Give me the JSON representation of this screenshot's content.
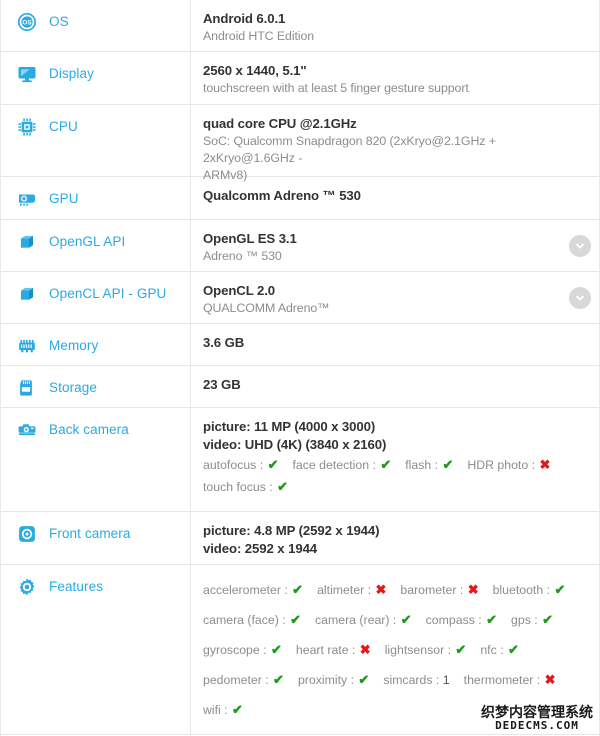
{
  "rows": [
    {
      "id": "os",
      "label": "OS",
      "icon": "os-icon",
      "primary": "Android 6.0.1",
      "secondary": [
        "Android HTC Edition"
      ],
      "expandable": false
    },
    {
      "id": "display",
      "label": "Display",
      "icon": "monitor-icon",
      "primary": "2560 x 1440, 5.1\"",
      "secondary": [
        "touchscreen with at least 5 finger gesture support"
      ],
      "expandable": false
    },
    {
      "id": "cpu",
      "label": "CPU",
      "icon": "cpu-chip-icon",
      "primary": "quad core CPU @2.1GHz",
      "secondary": [
        "SoC: Qualcomm Snapdragon 820 (2xKryo@2.1GHz + 2xKryo@1.6GHz -",
        "ARMv8)"
      ],
      "expandable": false
    },
    {
      "id": "gpu",
      "label": "GPU",
      "icon": "gpu-card-icon",
      "primary": "Qualcomm Adreno ™ 530",
      "secondary": [],
      "expandable": false
    },
    {
      "id": "opengl-api",
      "label": "OpenGL API",
      "icon": "cube-icon",
      "primary": "OpenGL ES 3.1",
      "secondary": [
        "Adreno ™ 530"
      ],
      "expandable": true
    },
    {
      "id": "opencl-api-gpu",
      "label": "OpenCL API - GPU",
      "icon": "cube-icon",
      "primary": "OpenCL 2.0",
      "secondary": [
        "QUALCOMM Adreno™"
      ],
      "expandable": true
    },
    {
      "id": "memory",
      "label": "Memory",
      "icon": "memory-ram-icon",
      "primary": "3.6 GB",
      "secondary": [],
      "expandable": false
    },
    {
      "id": "storage",
      "label": "Storage",
      "icon": "sd-card-icon",
      "primary": "23 GB",
      "secondary": [],
      "expandable": false
    },
    {
      "id": "back-camera",
      "label": "Back camera",
      "icon": "camera-icon",
      "primary": "picture: 11 MP (4000 x 3000)",
      "primary2": "video: UHD (4K) (3840 x 2160)",
      "secondary": [],
      "expandable": false,
      "feature_lines": [
        [
          {
            "name": "autofocus :",
            "value": "yes"
          },
          {
            "name": "face detection :",
            "value": "yes"
          },
          {
            "name": "flash :",
            "value": "yes"
          },
          {
            "name": "HDR photo :",
            "value": "no"
          }
        ],
        [
          {
            "name": "touch focus :",
            "value": "yes"
          }
        ]
      ]
    },
    {
      "id": "front-camera",
      "label": "Front camera",
      "icon": "front-camera-icon",
      "primary": "picture: 4.8 MP (2592 x 1944)",
      "primary2": "video: 2592 x 1944",
      "secondary": [],
      "expandable": false
    },
    {
      "id": "features",
      "label": "Features",
      "icon": "gear-icon",
      "primary": "",
      "secondary": [],
      "expandable": false,
      "feature_lines": [
        [
          {
            "name": "accelerometer :",
            "value": "yes"
          },
          {
            "name": "altimeter :",
            "value": "no"
          },
          {
            "name": "barometer :",
            "value": "no"
          },
          {
            "name": "bluetooth :",
            "value": "yes"
          }
        ],
        [
          {
            "name": "camera (face) :",
            "value": "yes"
          },
          {
            "name": "camera (rear) :",
            "value": "yes"
          },
          {
            "name": "compass :",
            "value": "yes"
          },
          {
            "name": "gps :",
            "value": "yes"
          }
        ],
        [
          {
            "name": "gyroscope :",
            "value": "yes"
          },
          {
            "name": "heart rate :",
            "value": "no"
          },
          {
            "name": "lightsensor :",
            "value": "yes"
          },
          {
            "name": "nfc :",
            "value": "yes"
          }
        ],
        [
          {
            "name": "pedometer :",
            "value": "yes"
          },
          {
            "name": "proximity :",
            "value": "yes"
          },
          {
            "name": "simcards :",
            "value": "1"
          },
          {
            "name": "thermometer :",
            "value": "no"
          }
        ],
        [
          {
            "name": "wifi :",
            "value": "yes"
          }
        ]
      ]
    }
  ],
  "marks": {
    "yes": "✔",
    "no": "✖"
  },
  "watermark": {
    "cn": "织梦内容管理系统",
    "en": "DEDECMS.COM"
  },
  "colors": {
    "label_blue": "#2aaae2",
    "value_dark": "#333333",
    "value_gray": "#8d8d8d",
    "check_green": "#1a9b1a",
    "cross_red": "#e11919",
    "divider": "#e6e6e6",
    "chevron_bg": "#d8d8d8"
  }
}
